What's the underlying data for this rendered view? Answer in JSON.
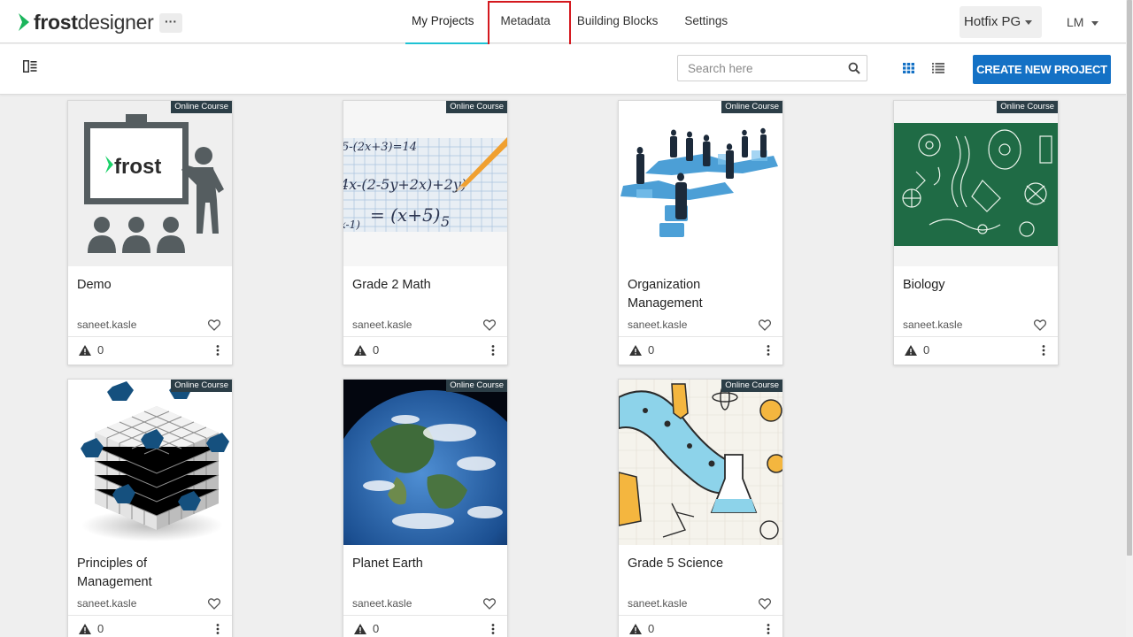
{
  "app": {
    "logo_brand": "frost",
    "logo_suffix": "designer"
  },
  "nav": {
    "more_label": "···",
    "tabs": [
      {
        "label": "My Projects",
        "active": true
      },
      {
        "label": "Metadata",
        "active": false,
        "highlighted": true
      },
      {
        "label": "Building Blocks",
        "active": false
      },
      {
        "label": "Settings",
        "active": false
      }
    ],
    "org_selector": "Hotfix PG",
    "user_initials": "LM"
  },
  "toolbar": {
    "search_placeholder": "Search here",
    "create_button": "CREATE NEW PROJECT"
  },
  "projects": [
    {
      "title": "Demo",
      "badge": "Online Course",
      "author": "saneet.kasle",
      "warnings": "0",
      "thumb_icon": "frost-teacher-icon"
    },
    {
      "title": "Grade 2 Math",
      "badge": "Online Course",
      "author": "saneet.kasle",
      "warnings": "0",
      "thumb_icon": "math-paper-image"
    },
    {
      "title": "Organization Management",
      "badge": "Online Course",
      "author": "saneet.kasle",
      "warnings": "0",
      "thumb_icon": "puzzle-people-image"
    },
    {
      "title": "Biology",
      "badge": "Online Course",
      "author": "saneet.kasle",
      "warnings": "0",
      "thumb_icon": "chalkboard-biology-image"
    },
    {
      "title": "Principles of Management",
      "badge": "Online Course",
      "author": "saneet.kasle",
      "warnings": "0",
      "thumb_icon": "cube-blocks-image"
    },
    {
      "title": "Planet Earth",
      "badge": "Online Course",
      "author": "saneet.kasle",
      "warnings": "0",
      "thumb_icon": "earth-image"
    },
    {
      "title": "Grade 5 Science",
      "badge": "Online Course",
      "author": "saneet.kasle",
      "warnings": "0",
      "thumb_icon": "science-doodle-image"
    }
  ],
  "colors": {
    "accent": "#1ec3d4",
    "primary_button": "#1471c5",
    "badge_bg": "#2c3e47",
    "highlight_box": "#d4181e"
  }
}
